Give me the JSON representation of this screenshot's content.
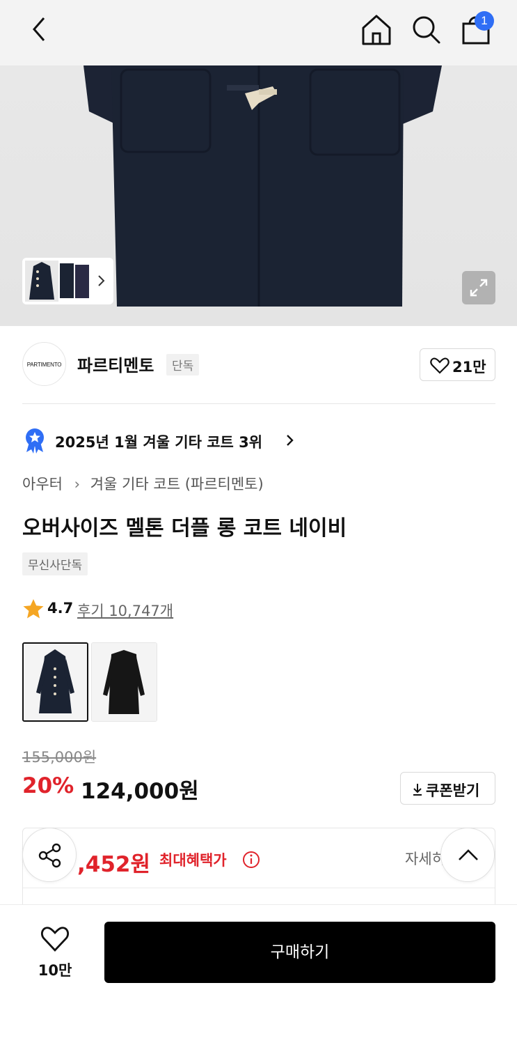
{
  "header": {
    "cart_count": "1"
  },
  "brand": {
    "logo_text": "PARTIMENTO",
    "name": "파르티멘토",
    "tag": "단독",
    "like_count": "21만"
  },
  "ranking": {
    "text": "2025년 1월 겨울 기타 코트 3위"
  },
  "breadcrumb": {
    "level1": "아우터",
    "level2": "겨울 기타 코트 (파르티멘토)"
  },
  "product": {
    "title": "오버사이즈 멜톤 더플 롱 코트 네이비",
    "exclusive_tag": "무신사단독",
    "rating": "4.7",
    "reviews": "후기 10,747개",
    "original_price": "155,000원",
    "discount": "20%",
    "price": "124,000원",
    "coupon_label": "쿠폰받기",
    "variants": [
      "navy",
      "black"
    ]
  },
  "benefit": {
    "price": ",452원",
    "label": "최대혜택가",
    "detail": "자세히"
  },
  "bottom": {
    "wish_count": "10만",
    "buy_label": "구매하기"
  },
  "colors": {
    "accent_red": "#e0232b",
    "badge_blue": "#2f6ef5",
    "coat_navy": "#1b2333"
  }
}
